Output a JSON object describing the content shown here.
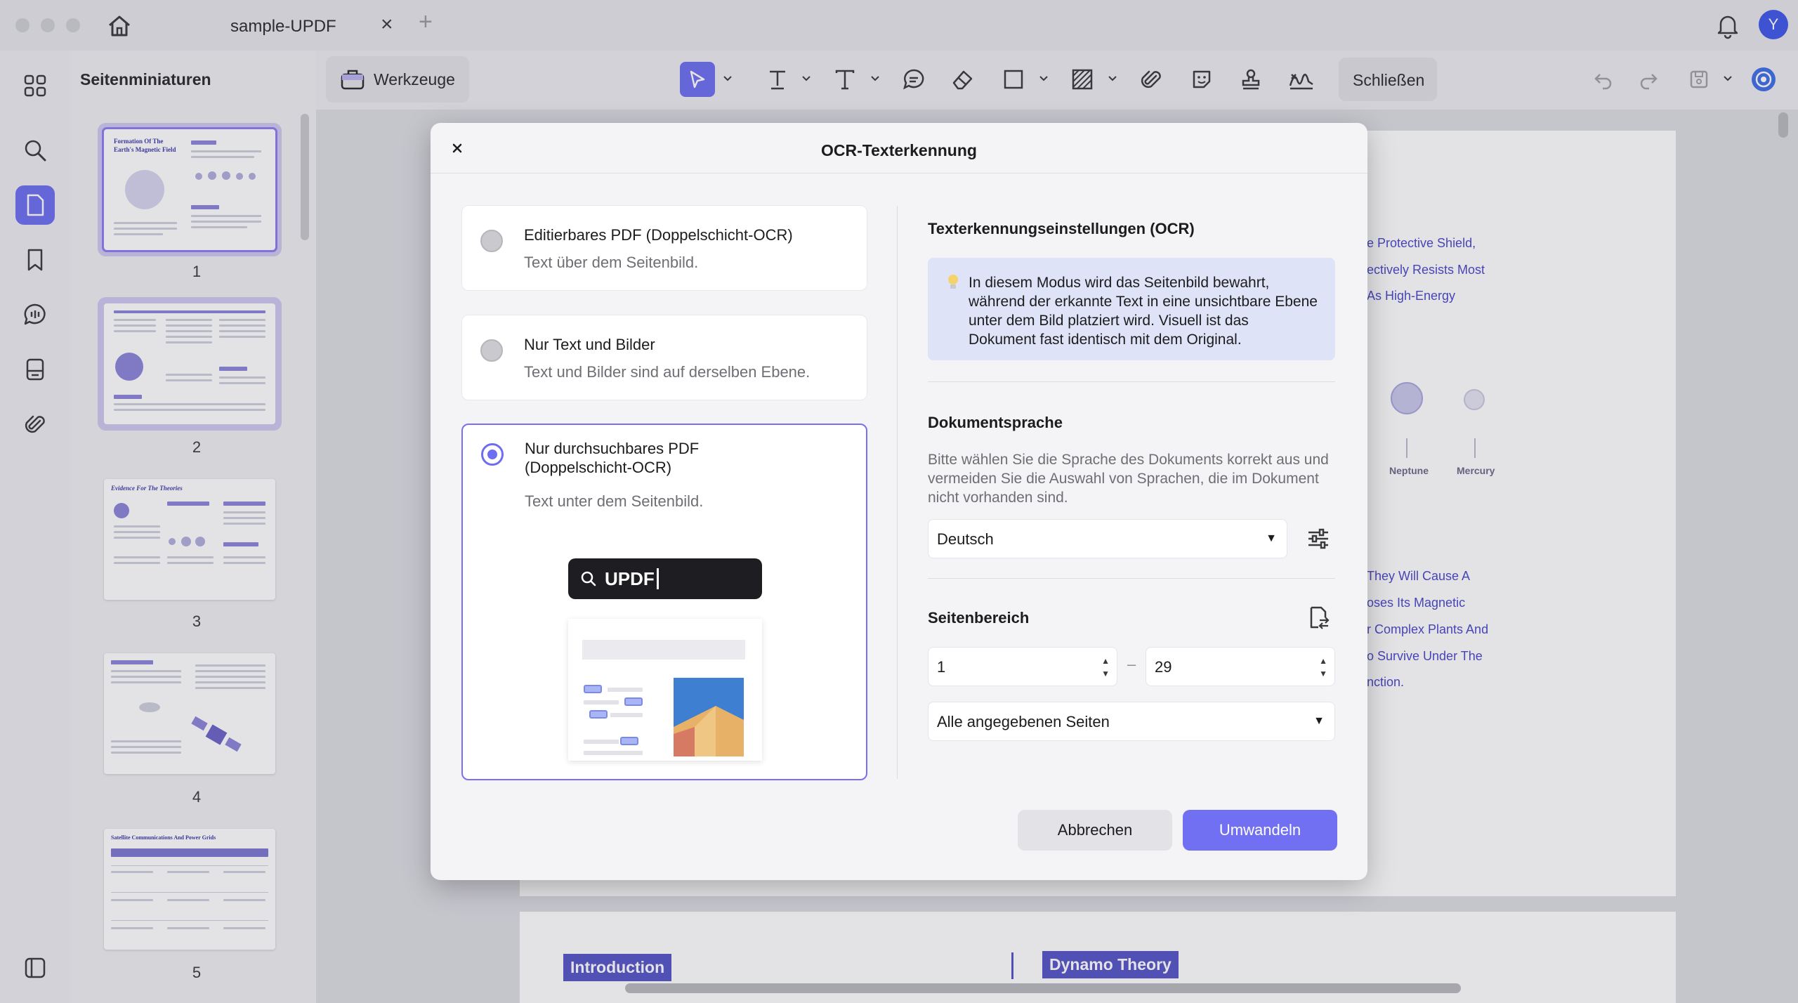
{
  "window": {
    "tab_title": "sample-UPDF",
    "tab_close": "×",
    "tab_add": "+",
    "avatar_initial": "Y"
  },
  "sidebar": {
    "title": "Seitenminiaturen",
    "pages": [
      "1",
      "2",
      "3",
      "4",
      "5"
    ]
  },
  "toolbar": {
    "tools_label": "Werkzeuge",
    "close_label": "Schließen"
  },
  "document": {
    "snippets": [
      "e Protective Shield,",
      "ectively Resists Most",
      "As High-Energy",
      "They Will Cause A",
      "oses Its Magnetic",
      "r Complex Plants And",
      "o Survive Under The",
      "nction."
    ],
    "planets": [
      "Neptune",
      "Mercury"
    ],
    "sections": [
      "Introduction",
      "Dynamo Theory"
    ],
    "thumb_headings": [
      "Formation Of The",
      "Earth's Magnetic Field",
      "Evidence For The Theories",
      "Satellite Communications And Power Grids"
    ]
  },
  "dialog": {
    "title": "OCR-Texterkennung",
    "close": "×",
    "options": [
      {
        "title": "Editierbares PDF (Doppelschicht-OCR)",
        "subtitle": "Text über dem Seitenbild.",
        "selected": false
      },
      {
        "title": "Nur Text und Bilder",
        "subtitle": "Text und Bilder sind auf derselben Ebene.",
        "selected": false
      },
      {
        "title": "Nur durchsuchbares PDF\n(Doppelschicht-OCR)",
        "subtitle": "Text unter dem Seitenbild.",
        "selected": true
      }
    ],
    "preview_search_text": "UPDF",
    "settings_title": "Texterkennungseinstellungen (OCR)",
    "info_text": "In diesem Modus wird das Seitenbild bewahrt, während der erkannte Text in eine unsichtbare Ebene unter dem Bild platziert wird. Visuell ist das Dokument fast identisch mit dem Original.",
    "language_title": "Dokumentsprache",
    "language_desc": "Bitte wählen Sie die Sprache des Dokuments korrekt aus und vermeiden Sie die Auswahl von Sprachen, die im Dokument nicht vorhanden sind.",
    "language_value": "Deutsch",
    "range_title": "Seitenbereich",
    "range_from": "1",
    "range_to": "29",
    "range_dash": "–",
    "pages_select": "Alle angegebenen Seiten",
    "cancel": "Abbrechen",
    "convert": "Umwandeln"
  },
  "colors": {
    "accent": "#6d6ef0",
    "primary_button": "#7270f2",
    "info_bg": "#dfe3f7"
  }
}
